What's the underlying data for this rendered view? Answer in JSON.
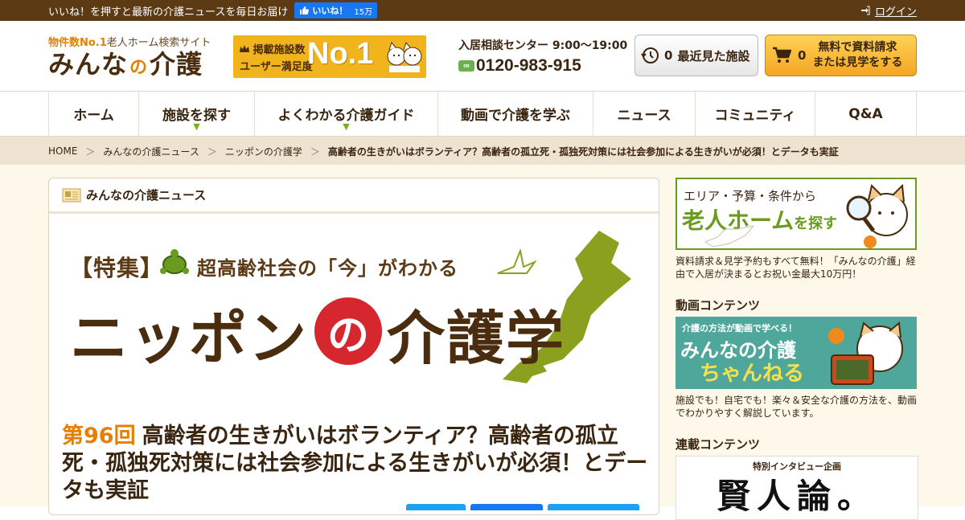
{
  "topbar": {
    "message": "いいね！を押すと最新の介護ニュースを毎日お届け",
    "like_label": "いいね！",
    "like_count": "15万",
    "login_label": "ログイン"
  },
  "header": {
    "logo_tag_prefix": "物件数No.1",
    "logo_tag_suffix": "老人ホーム検索サイト",
    "logo_name_a": "みんな",
    "logo_name_no": "の",
    "logo_name_b": "介護",
    "banner_line1": "掲載施設数",
    "banner_line2": "ユーザー満足度",
    "banner_big": "No.1",
    "contact_hours": "入居相談センター 9:00〜19:00",
    "contact_tel": "0120-983-915",
    "recent_count": "0",
    "recent_label": "最近見た施設",
    "request_count": "0",
    "request_line1": "無料で資料請求",
    "request_line2": "または見学をする"
  },
  "nav": [
    {
      "label": "ホーム"
    },
    {
      "label": "施設を探す"
    },
    {
      "label": "よくわかる介護ガイド"
    },
    {
      "label": "動画で介護を学ぶ"
    },
    {
      "label": "ニュース"
    },
    {
      "label": "コミュニティ"
    },
    {
      "label": "Q&A"
    }
  ],
  "breadcrumb": {
    "home": "HOME",
    "news": "みんなの介護ニュース",
    "series": "ニッポンの介護学",
    "current": "高齢者の生きがいはボランティア？高齢者の孤立死・孤独死対策には社会参加による生きがいが必須！とデータも実証"
  },
  "main": {
    "section_title": "みんなの介護ニュース",
    "hero_series": "【特集】",
    "hero_sub": "超高齢社会の「今」がわかる",
    "hero_title_a": "ニッポン",
    "hero_title_no": "の",
    "hero_title_b": "介護学",
    "episode": "第96回",
    "article_title": "高齢者の生きがいはボランティア？高齢者の孤立死・孤独死対策には社会参加による生きがいが必須！とデータも実証"
  },
  "sidebar": {
    "ban1_line1": "エリア・予算・条件から",
    "ban1_line2": "老人ホーム",
    "ban1_line2b": "を探す",
    "ban1_desc": "資料請求＆見学予約もすべて無料！「みんなの介護」経由で入居が決まるとお祝い金最大10万円！",
    "video_heading": "動画コンテンツ",
    "ban2_a": "介護の方法が動画で学べる！",
    "ban2_b": "みんなの介護",
    "ban2_c": "ちゃんねる",
    "video_desc": "施設でも！自宅でも！楽々＆安全な介護の方法を、動画でわかりやすく解説しています。",
    "serial_heading": "連載コンテンツ",
    "ban3_a": "特別インタビュー企画",
    "ban3_b": "賢人論。"
  },
  "colors": {
    "brown": "#5b3a14",
    "orange": "#e67e00",
    "green": "#7cae1c",
    "red": "#d6262e",
    "cream": "#fdf8ea"
  }
}
